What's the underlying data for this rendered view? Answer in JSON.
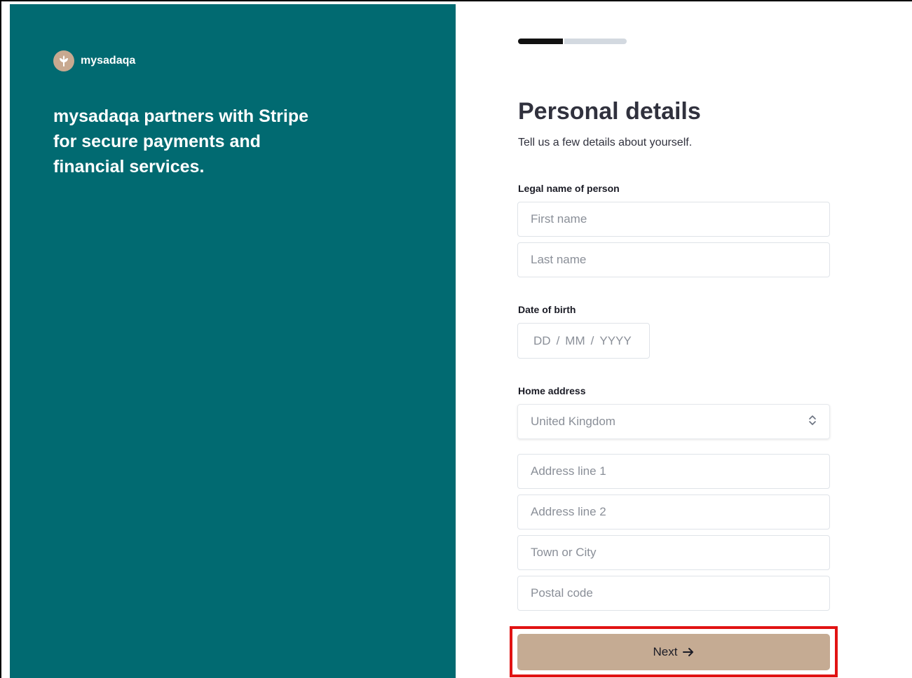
{
  "brand": {
    "name": "mysadaqa",
    "tagline": "mysadaqa partners with Stripe for secure payments and financial services."
  },
  "progress": {
    "current_step": 1,
    "total_steps": 2
  },
  "form": {
    "title": "Personal details",
    "subtitle": "Tell us a few details about yourself.",
    "legal_name": {
      "label": "Legal name of person",
      "first_name_placeholder": "First name",
      "last_name_placeholder": "Last name"
    },
    "dob": {
      "label": "Date of birth",
      "day_placeholder": "DD",
      "month_placeholder": "MM",
      "year_placeholder": "YYYY",
      "separator": "/"
    },
    "address": {
      "label": "Home address",
      "country_value": "United Kingdom",
      "line1_placeholder": "Address line 1",
      "line2_placeholder": "Address line 2",
      "city_placeholder": "Town or City",
      "postal_placeholder": "Postal code"
    },
    "next_label": "Next"
  },
  "colors": {
    "panel": "#016a71",
    "accent": "#c5ab93",
    "highlight": "#e11313"
  },
  "icons": {
    "logo": "leaf-logo-icon",
    "select": "chevron-up-down-icon",
    "next": "arrow-right-icon"
  }
}
